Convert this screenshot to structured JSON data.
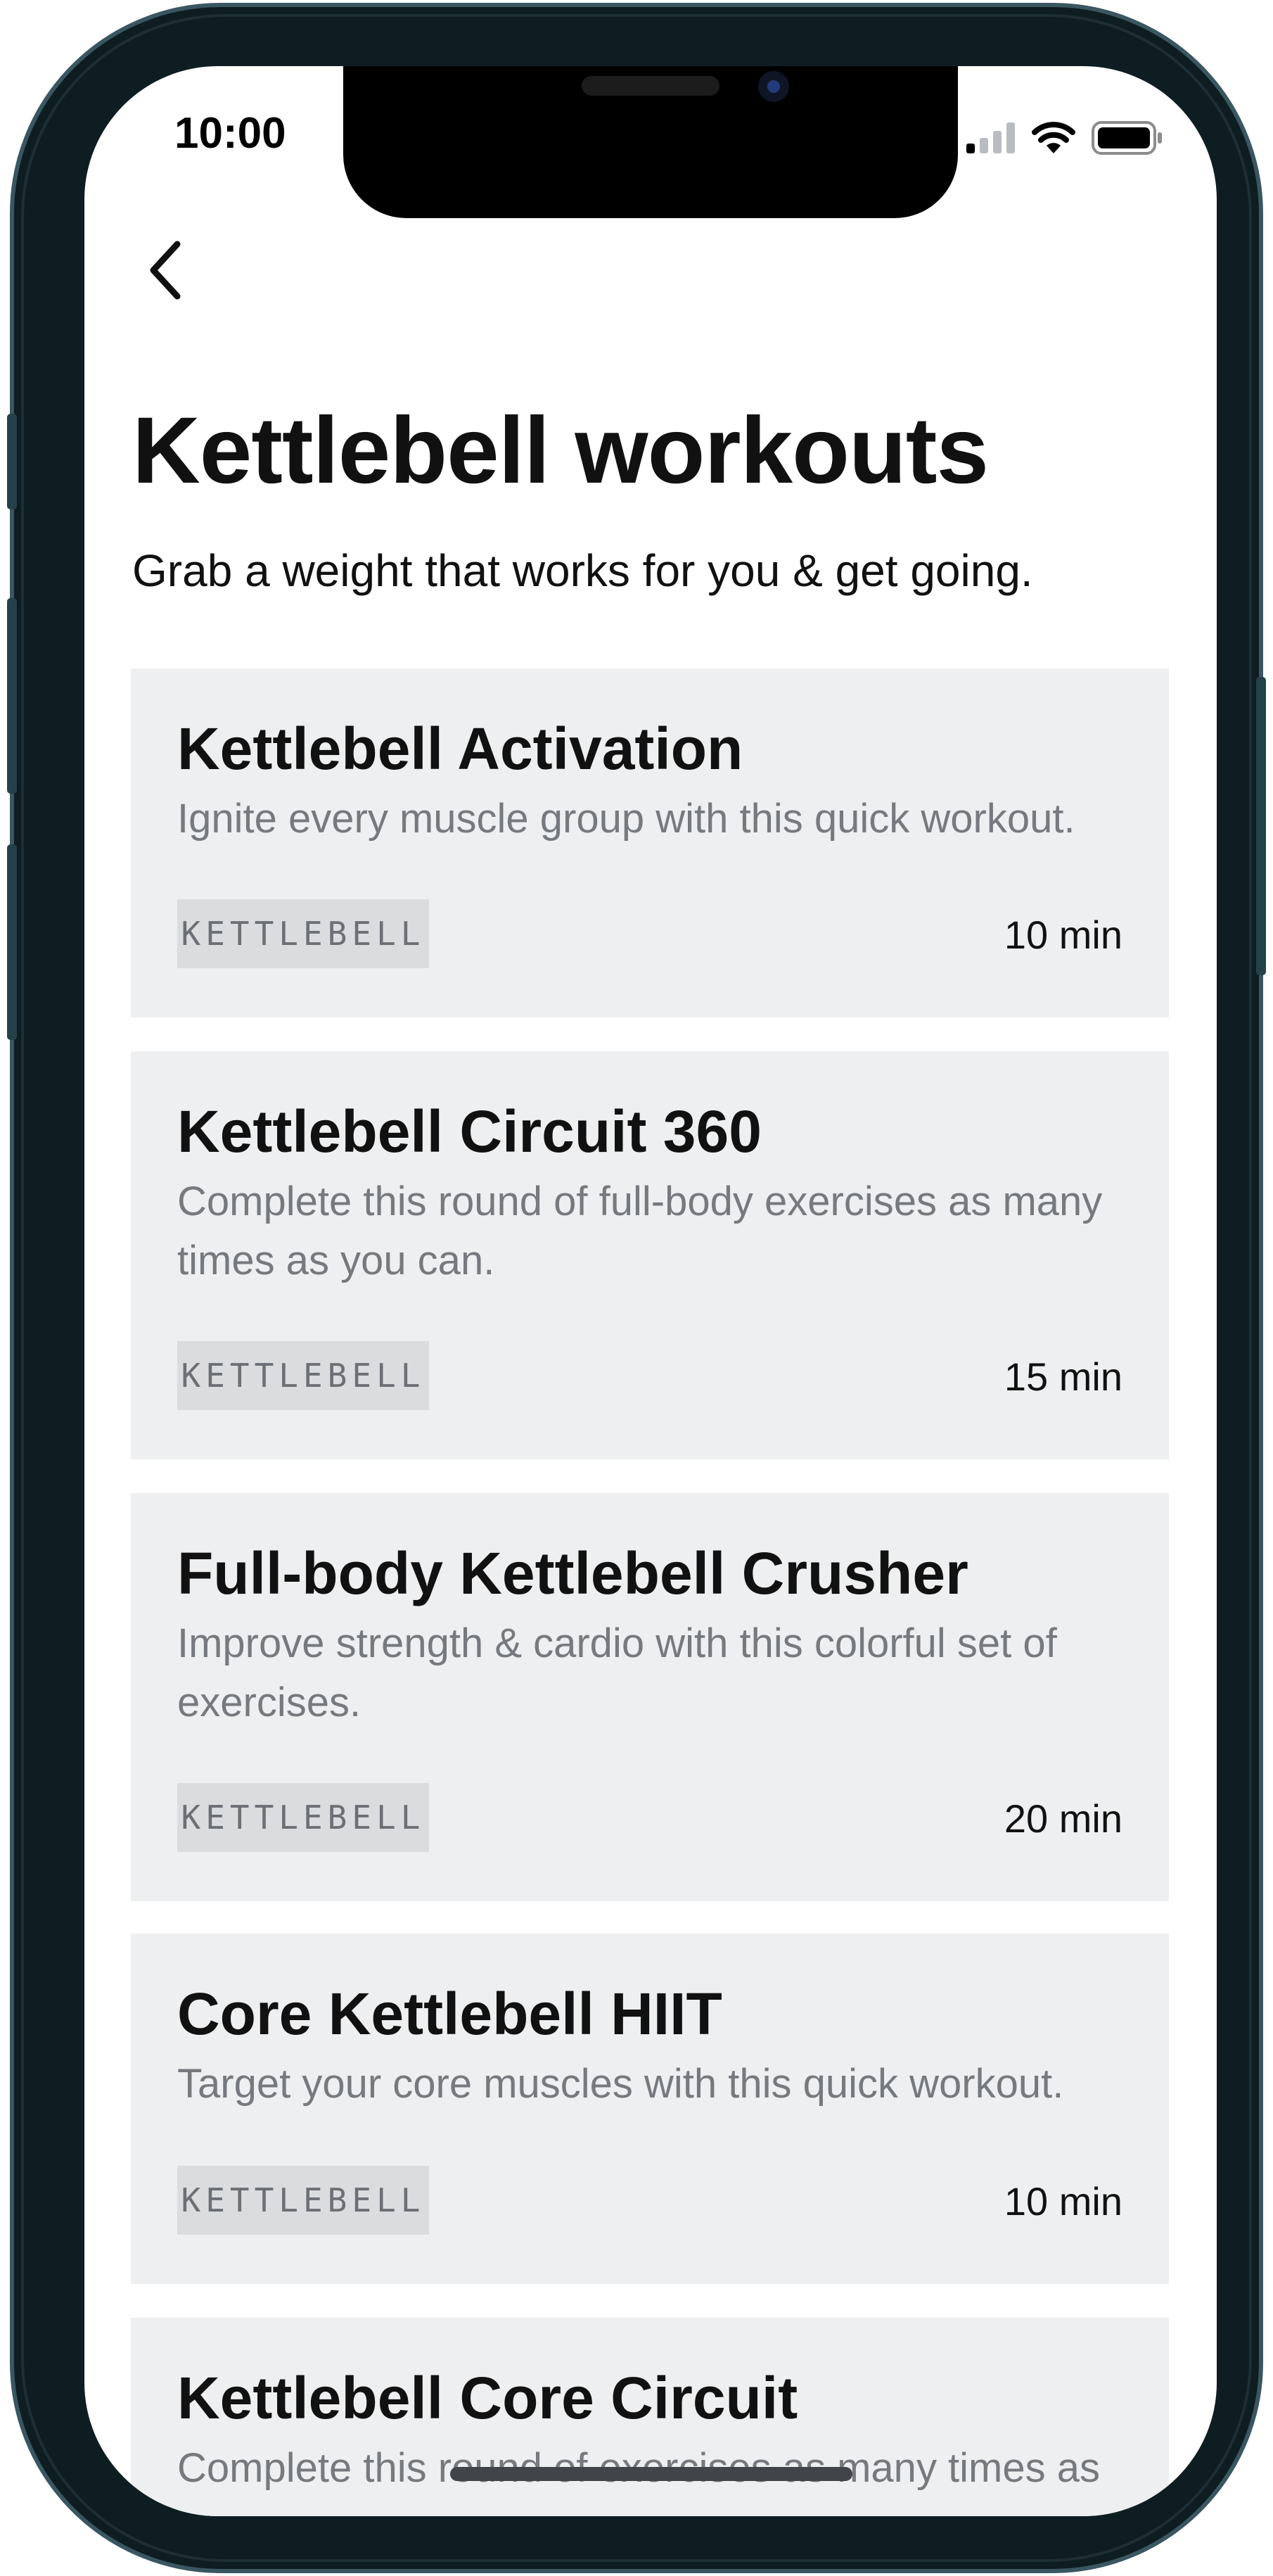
{
  "status_bar": {
    "time": "10:00"
  },
  "nav": {
    "back_icon": "chevron-left-icon"
  },
  "header": {
    "title": "Kettlebell workouts",
    "subtitle": "Grab a weight that works for you & get going."
  },
  "workouts": [
    {
      "title": "Kettlebell Activation",
      "description": "Ignite every muscle group with this quick workout.",
      "tag": "KETTLEBELL",
      "duration": "10 min"
    },
    {
      "title": "Kettlebell Circuit 360",
      "description": "Complete this round of full-body exercises as many times as you can.",
      "tag": "KETTLEBELL",
      "duration": "15 min"
    },
    {
      "title": "Full-body Kettlebell Crusher",
      "description": "Improve strength & cardio with this colorful set of exercises.",
      "tag": "KETTLEBELL",
      "duration": "20 min"
    },
    {
      "title": "Core Kettlebell HIIT",
      "description": "Target your core muscles with this quick workout.",
      "tag": "KETTLEBELL",
      "duration": "10 min"
    },
    {
      "title": "Kettlebell Core Circuit",
      "description": "Complete this round of exercises as many times as"
    }
  ],
  "colors": {
    "card_bg": "#eeeff0",
    "tag_bg": "#dadcde",
    "description_text": "#767a7e",
    "frame": "#0e1d21"
  }
}
